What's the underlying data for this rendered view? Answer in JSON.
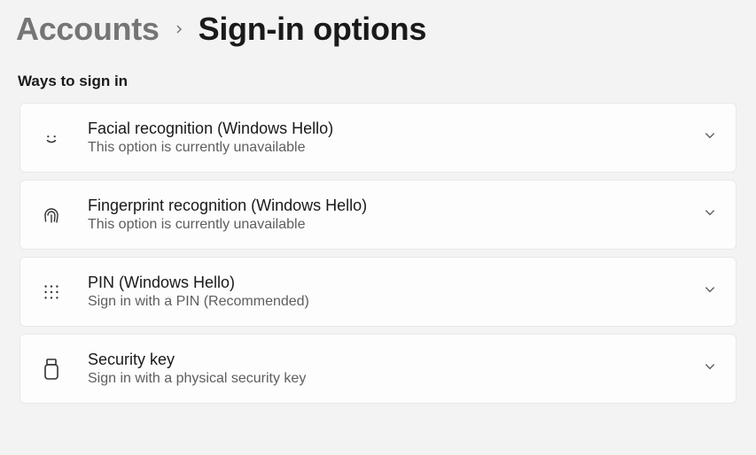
{
  "breadcrumb": {
    "parent": "Accounts",
    "current": "Sign-in options"
  },
  "section_heading": "Ways to sign in",
  "options": [
    {
      "icon": "face-icon",
      "title": "Facial recognition (Windows Hello)",
      "description": "This option is currently unavailable"
    },
    {
      "icon": "fingerprint-icon",
      "title": "Fingerprint recognition (Windows Hello)",
      "description": "This option is currently unavailable"
    },
    {
      "icon": "pin-icon",
      "title": "PIN (Windows Hello)",
      "description": "Sign in with a PIN (Recommended)"
    },
    {
      "icon": "security-key-icon",
      "title": "Security key",
      "description": "Sign in with a physical security key"
    }
  ]
}
